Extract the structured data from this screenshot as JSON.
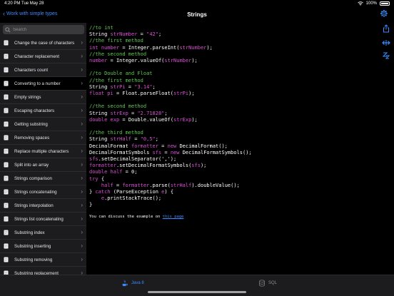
{
  "status_bar": {
    "time": "4:20 PM",
    "date": "Tue May 28",
    "battery": "100%"
  },
  "navbar": {
    "back_label": "Work with simple types",
    "title": "Strings"
  },
  "sidebar": {
    "search_placeholder": "Search",
    "items": [
      {
        "label": "Change the case of characters"
      },
      {
        "label": "Character replacement"
      },
      {
        "label": "Characters count"
      },
      {
        "label": "Converting to a number"
      },
      {
        "label": "Empty strings"
      },
      {
        "label": "Escaping characters"
      },
      {
        "label": "Getting substring"
      },
      {
        "label": "Removing spaces"
      },
      {
        "label": "Replace multiple characters"
      },
      {
        "label": "Split into an array"
      },
      {
        "label": "Strings comparison"
      },
      {
        "label": "Strings concatenating"
      },
      {
        "label": "Strings interpolation"
      },
      {
        "label": "Strings list concatenating"
      },
      {
        "label": "Substring index"
      },
      {
        "label": "Substring inserting"
      },
      {
        "label": "Substring removing"
      },
      {
        "label": "Substring replacement"
      }
    ],
    "selected": "Converting to a number"
  },
  "code_lines": [
    [
      {
        "t": "//to int",
        "c": "comment"
      }
    ],
    [
      {
        "t": "String ",
        "c": "plain"
      },
      {
        "t": "strNumber",
        "c": "var"
      },
      {
        "t": " = ",
        "c": "plain"
      },
      {
        "t": "\"42\"",
        "c": "str"
      },
      {
        "t": ";",
        "c": "plain"
      }
    ],
    [
      {
        "t": "//the first method",
        "c": "comment"
      }
    ],
    [
      {
        "t": "int ",
        "c": "kw"
      },
      {
        "t": "number",
        "c": "var"
      },
      {
        "t": " = Integer.parseInt(",
        "c": "plain"
      },
      {
        "t": "strNumber",
        "c": "var"
      },
      {
        "t": ");",
        "c": "plain"
      }
    ],
    [
      {
        "t": "//the second method",
        "c": "comment"
      }
    ],
    [
      {
        "t": "number",
        "c": "var"
      },
      {
        "t": " = Integer.valueOf(",
        "c": "plain"
      },
      {
        "t": "strNumber",
        "c": "var"
      },
      {
        "t": ");",
        "c": "plain"
      }
    ],
    [],
    [
      {
        "t": "//to Double and Float",
        "c": "comment"
      }
    ],
    [
      {
        "t": "//the first method",
        "c": "comment"
      }
    ],
    [
      {
        "t": "String ",
        "c": "plain"
      },
      {
        "t": "strPi",
        "c": "var"
      },
      {
        "t": " = ",
        "c": "plain"
      },
      {
        "t": "\"3.14\"",
        "c": "str"
      },
      {
        "t": ";",
        "c": "plain"
      }
    ],
    [
      {
        "t": "float ",
        "c": "kw"
      },
      {
        "t": "pi",
        "c": "var"
      },
      {
        "t": " = Float.parseFloat(",
        "c": "plain"
      },
      {
        "t": "strPi",
        "c": "var"
      },
      {
        "t": ");",
        "c": "plain"
      }
    ],
    [],
    [
      {
        "t": "//the second method",
        "c": "comment"
      }
    ],
    [
      {
        "t": "String ",
        "c": "plain"
      },
      {
        "t": "strExp",
        "c": "var"
      },
      {
        "t": " = ",
        "c": "plain"
      },
      {
        "t": "\"2.71828\"",
        "c": "str"
      },
      {
        "t": ";",
        "c": "plain"
      }
    ],
    [
      {
        "t": "double ",
        "c": "kw"
      },
      {
        "t": "exp",
        "c": "var"
      },
      {
        "t": " = Double.valueOf(",
        "c": "plain"
      },
      {
        "t": "strExp",
        "c": "var"
      },
      {
        "t": ");",
        "c": "plain"
      }
    ],
    [],
    [
      {
        "t": "//the third method",
        "c": "comment"
      }
    ],
    [
      {
        "t": "String ",
        "c": "plain"
      },
      {
        "t": "strHalf",
        "c": "var"
      },
      {
        "t": " = ",
        "c": "plain"
      },
      {
        "t": "\"0,5\"",
        "c": "str"
      },
      {
        "t": ";",
        "c": "plain"
      }
    ],
    [
      {
        "t": "DecimalFormat ",
        "c": "plain"
      },
      {
        "t": "formatter",
        "c": "var"
      },
      {
        "t": " = ",
        "c": "plain"
      },
      {
        "t": "new ",
        "c": "kw"
      },
      {
        "t": "DecimalFormat();",
        "c": "plain"
      }
    ],
    [
      {
        "t": "DecimalFormatSymbols ",
        "c": "plain"
      },
      {
        "t": "sfs",
        "c": "var"
      },
      {
        "t": " = ",
        "c": "plain"
      },
      {
        "t": "new ",
        "c": "kw"
      },
      {
        "t": "DecimalFormatSymbols();",
        "c": "plain"
      }
    ],
    [
      {
        "t": "sfs",
        "c": "var"
      },
      {
        "t": ".setDecimalSeparator(',');",
        "c": "plain"
      }
    ],
    [
      {
        "t": "formatter",
        "c": "var"
      },
      {
        "t": ".setDecimalFormatSymbols(",
        "c": "plain"
      },
      {
        "t": "sfs",
        "c": "var"
      },
      {
        "t": ");",
        "c": "plain"
      }
    ],
    [
      {
        "t": "double ",
        "c": "kw"
      },
      {
        "t": "half",
        "c": "var"
      },
      {
        "t": " = 0;",
        "c": "plain"
      }
    ],
    [
      {
        "t": "try",
        "c": "kw"
      },
      {
        "t": " {",
        "c": "plain"
      }
    ],
    [
      {
        "t": "    ",
        "c": "plain"
      },
      {
        "t": "half",
        "c": "var"
      },
      {
        "t": " = ",
        "c": "plain"
      },
      {
        "t": "formatter",
        "c": "var"
      },
      {
        "t": ".parse(",
        "c": "plain"
      },
      {
        "t": "strHalf",
        "c": "var"
      },
      {
        "t": ").doubleValue();",
        "c": "plain"
      }
    ],
    [
      {
        "t": "} ",
        "c": "plain"
      },
      {
        "t": "catch",
        "c": "kw"
      },
      {
        "t": " (ParseException ",
        "c": "plain"
      },
      {
        "t": "e",
        "c": "var"
      },
      {
        "t": ") {",
        "c": "plain"
      }
    ],
    [
      {
        "t": "    ",
        "c": "plain"
      },
      {
        "t": "e",
        "c": "var"
      },
      {
        "t": ".printStackTrace();",
        "c": "plain"
      }
    ],
    [
      {
        "t": "}",
        "c": "plain"
      }
    ]
  ],
  "discuss": {
    "text": "You can discuss the example on ",
    "link": "this page"
  },
  "tabs": [
    {
      "label": "Java 8"
    },
    {
      "label": "SQL"
    }
  ],
  "colors": {
    "accent": "#3a8bff",
    "comment": "#5ec84e",
    "identifier": "#d94fd3",
    "background": "#000000",
    "sidebar": "#1c1c1e"
  }
}
